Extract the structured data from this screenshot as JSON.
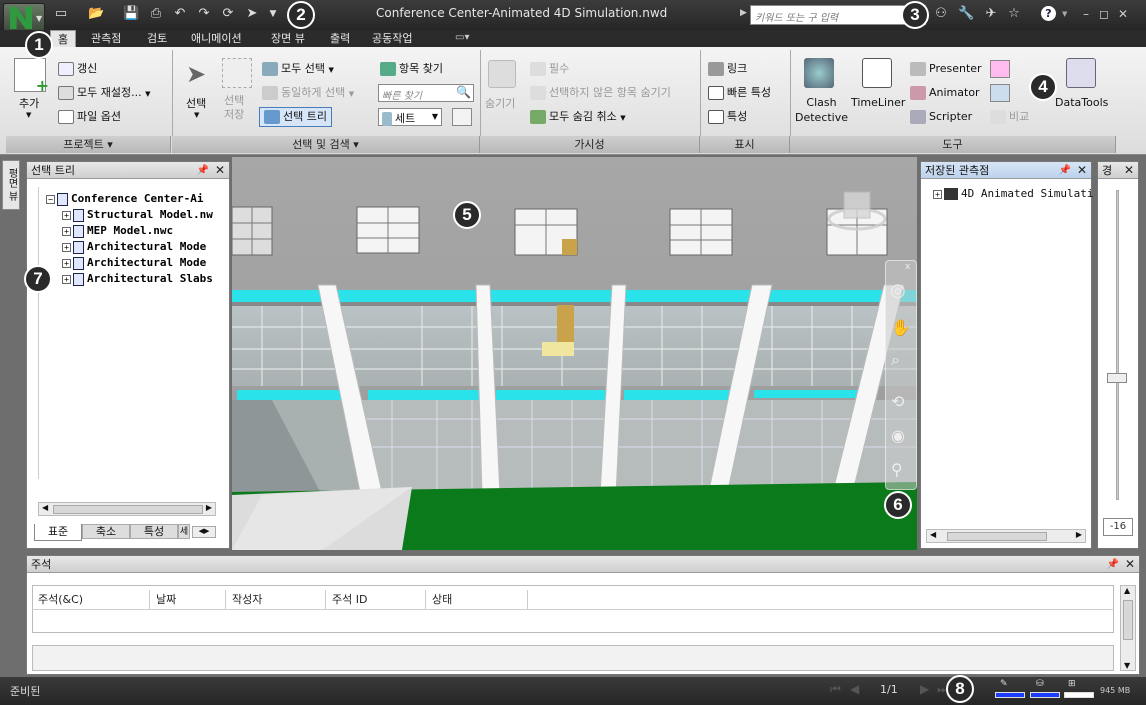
{
  "window": {
    "title": "Conference Center-Animated 4D Simulation.nwd"
  },
  "search": {
    "placeholder": "키워드 또는 구 입력"
  },
  "tabs": [
    {
      "label": "홈"
    },
    {
      "label": "관측점"
    },
    {
      "label": "검토"
    },
    {
      "label": "애니메이션"
    },
    {
      "label": "장면 뷰"
    },
    {
      "label": "출력"
    },
    {
      "label": "공동작업"
    }
  ],
  "ribbon": {
    "project": {
      "title": "프로젝트",
      "add": "추가",
      "refresh": "갱신",
      "reset_all": "모두 재설정...",
      "file_options": "파일 옵션"
    },
    "select": {
      "title": "선택 및 검색",
      "select": "선택",
      "save_selection": "선택\n저장",
      "select_all": "모두 선택",
      "select_same": "동일하게 선택",
      "selection_tree": "선택 트리",
      "find_items": "항목 찾기",
      "quick_find_placeholder": "빠른 찾기",
      "sets": "세트"
    },
    "visibility": {
      "title": "가시성",
      "hide": "숨기기",
      "require": "필수",
      "hide_unselected": "선택하지 않은 항목 숨기기",
      "unhide_all": "모두 숨김 취소"
    },
    "display": {
      "title": "표시",
      "links": "링크",
      "quick_props": "빠른 특성",
      "properties": "특성"
    },
    "tools": {
      "title": "도구",
      "clash": "Clash\nDetective",
      "timeliner": "TimeLiner",
      "presenter": "Presenter",
      "animator": "Animator",
      "scripter": "Scripter",
      "compare": "비교",
      "datatools": "DataTools"
    }
  },
  "side_tab": {
    "label": "평면 뷰"
  },
  "selection_tree": {
    "title": "선택 트리",
    "root": "Conference Center-Ai",
    "items": [
      "Structural Model.nw",
      "MEP Model.nwc",
      "Architectural Mode",
      "Architectural Mode",
      "Architectural Slabs"
    ],
    "tabs": [
      "표준",
      "축소",
      "특성",
      "세"
    ]
  },
  "saved_viewpoints": {
    "title": "저장된 관측점",
    "items": [
      "4D Animated Simulati"
    ]
  },
  "right_slider": {
    "title": "경",
    "value": "-16"
  },
  "comments": {
    "title": "주석",
    "columns": [
      "주석(&C)",
      "날짜",
      "작성자",
      "주석 ID",
      "상태"
    ]
  },
  "status": {
    "ready": "준비된",
    "page": "1/1",
    "memory": "945 MB"
  },
  "callouts": [
    "1",
    "2",
    "3",
    "4",
    "5",
    "6",
    "7",
    "8"
  ]
}
